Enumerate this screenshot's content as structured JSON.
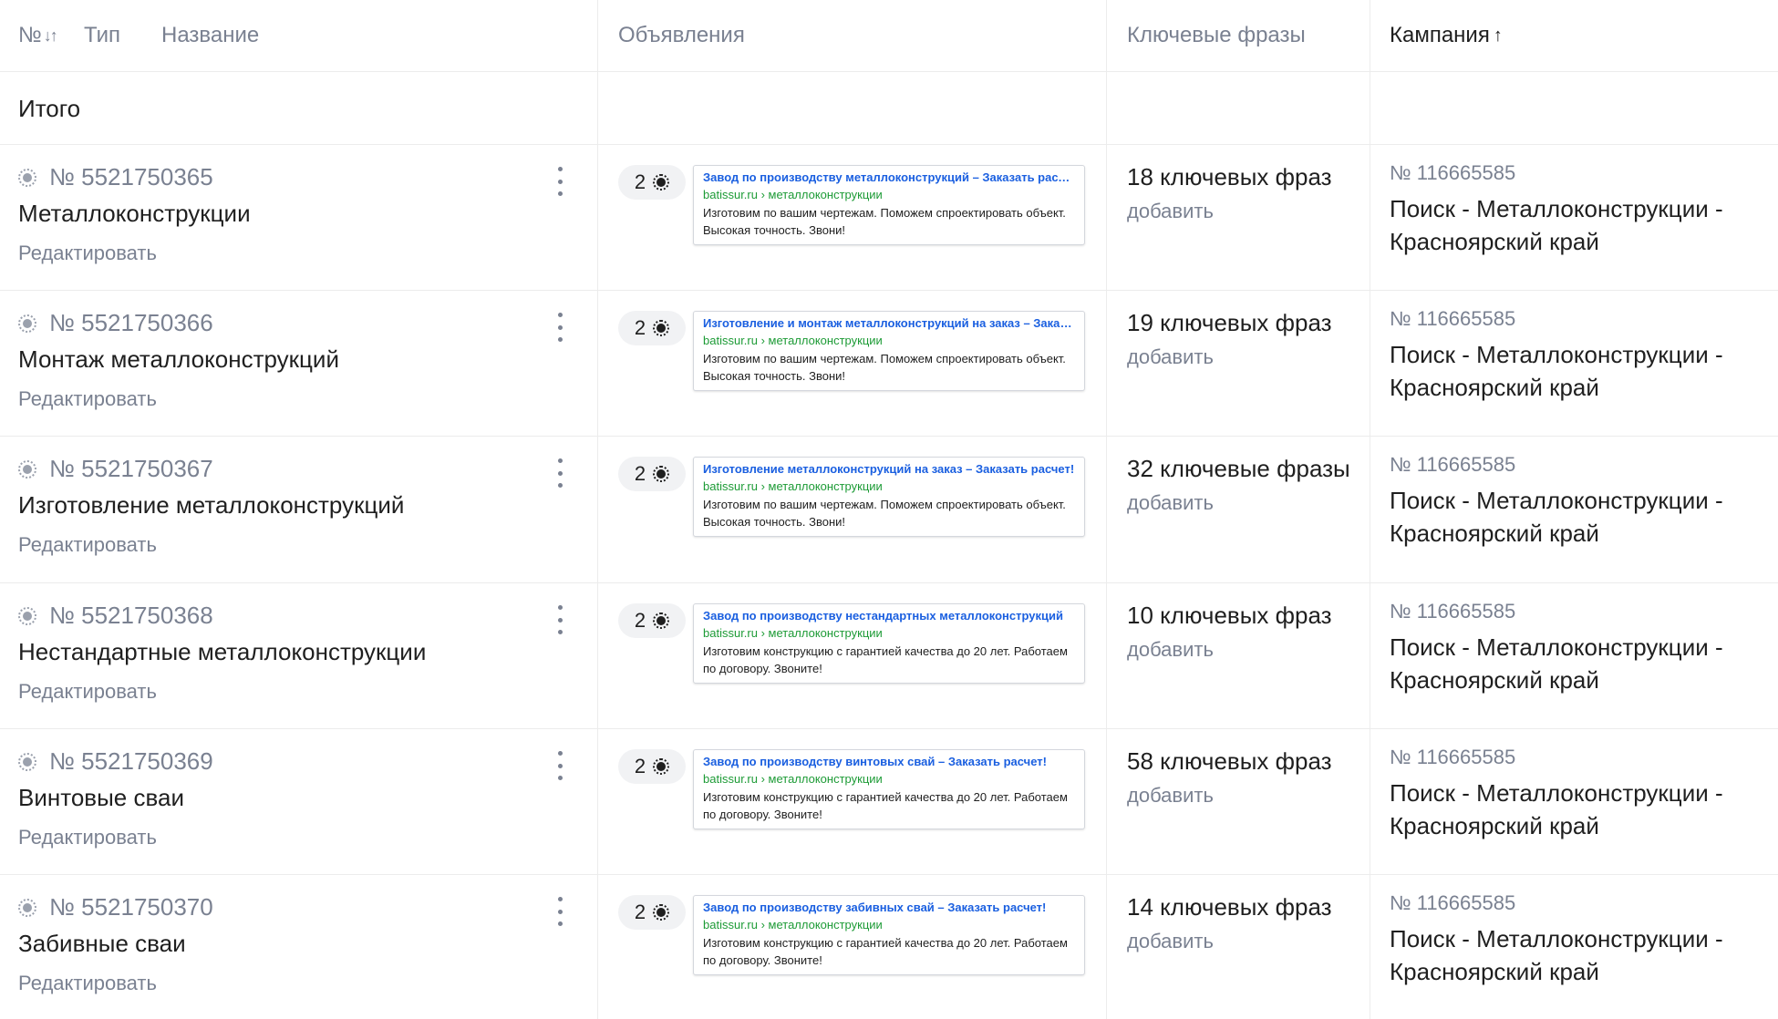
{
  "header": {
    "number": "№",
    "type": "Тип",
    "name": "Название",
    "ads": "Объявления",
    "keywords": "Ключевые фразы",
    "campaign": "Кампания"
  },
  "total_label": "Итого",
  "edit_label": "Редактировать",
  "add_label": "добавить",
  "rows": [
    {
      "id": "№ 5521750365",
      "name": "Металлоконструкции",
      "ad_count": "2",
      "ad_title": "Завод по производству металлоконструкций – Заказать расчет!",
      "ad_url": "batissur.ru › металлоконструкции",
      "ad_text": "Изготовим по вашим чертежам. Поможем спроектировать объект. Высокая точность. Звони!",
      "keywords": "18 ключевых фраз",
      "campaign_id": "№ 116665585",
      "campaign_name": "Поиск - Металлоконструкции - Красноярский край"
    },
    {
      "id": "№ 5521750366",
      "name": "Монтаж металлоконструкций",
      "ad_count": "2",
      "ad_title": "Изготовление и монтаж металлоконструкций на заказ – Заказать",
      "ad_url": "batissur.ru › металлоконструкции",
      "ad_text": "Изготовим по вашим чертежам. Поможем спроектировать объект. Высокая точность. Звони!",
      "keywords": "19 ключевых фраз",
      "campaign_id": "№ 116665585",
      "campaign_name": "Поиск - Металлоконструкции - Красноярский край"
    },
    {
      "id": "№ 5521750367",
      "name": "Изготовление металлоконструкций",
      "ad_count": "2",
      "ad_title": "Изготовление металлоконструкций на заказ – Заказать расчет!",
      "ad_url": "batissur.ru › металлоконструкции",
      "ad_text": "Изготовим по вашим чертежам. Поможем спроектировать объект. Высокая точность. Звони!",
      "keywords": "32 ключевые фразы",
      "campaign_id": "№ 116665585",
      "campaign_name": "Поиск - Металлоконструкции - Красноярский край"
    },
    {
      "id": "№ 5521750368",
      "name": "Нестандартные металлоконструкции",
      "ad_count": "2",
      "ad_title": "Завод по производству нестандартных металлоконструкций",
      "ad_url": "batissur.ru › металлоконструкции",
      "ad_text": "Изготовим конструкцию с гарантией качества до 20 лет. Работаем по договору. Звоните!",
      "keywords": "10 ключевых фраз",
      "campaign_id": "№ 116665585",
      "campaign_name": "Поиск - Металлоконструкции - Красноярский край"
    },
    {
      "id": "№ 5521750369",
      "name": "Винтовые сваи",
      "ad_count": "2",
      "ad_title": "Завод по производству винтовых свай – Заказать расчет!",
      "ad_url": "batissur.ru › металлоконструкции",
      "ad_text": "Изготовим конструкцию с гарантией качества до 20 лет. Работаем по договору. Звоните!",
      "keywords": "58 ключевых фраз",
      "campaign_id": "№ 116665585",
      "campaign_name": "Поиск - Металлоконструкции - Красноярский край"
    },
    {
      "id": "№ 5521750370",
      "name": "Забивные сваи",
      "ad_count": "2",
      "ad_title": "Завод по производству забивных свай – Заказать расчет!",
      "ad_url": "batissur.ru › металлоконструкции",
      "ad_text": "Изготовим конструкцию с гарантией качества до 20 лет. Работаем по договору. Звоните!",
      "keywords": "14 ключевых фраз",
      "campaign_id": "№ 116665585",
      "campaign_name": "Поиск - Металлоконструкции - Красноярский край"
    }
  ]
}
